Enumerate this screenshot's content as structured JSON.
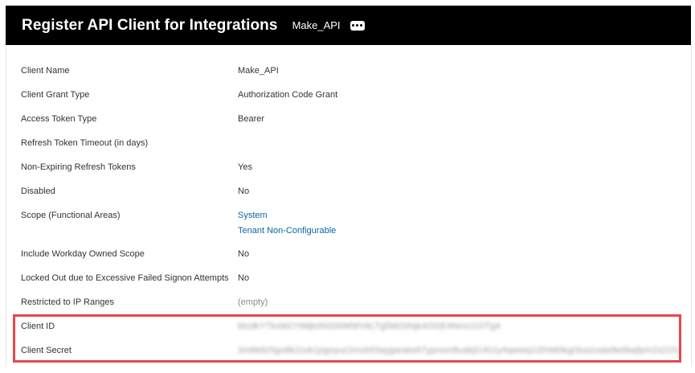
{
  "header": {
    "title": "Register API Client for Integrations",
    "subtitle": "Make_API",
    "related_actions_icon": "ellipsis-icon"
  },
  "fields": [
    {
      "label": "Client Name",
      "value": "Make_API"
    },
    {
      "label": "Client Grant Type",
      "value": "Authorization Code Grant"
    },
    {
      "label": "Access Token Type",
      "value": "Bearer"
    },
    {
      "label": "Refresh Token Timeout (in days)",
      "value": ""
    },
    {
      "label": "Non-Expiring Refresh Tokens",
      "value": "Yes"
    },
    {
      "label": "Disabled",
      "value": "No"
    },
    {
      "label": "Scope (Functional Areas)",
      "links": [
        "System",
        "Tenant Non-Configurable"
      ]
    },
    {
      "label": "Include Workday Owned Scope",
      "value": "No"
    },
    {
      "label": "Locked Out due to Excessive Failed Signon Attempts",
      "value": "No"
    },
    {
      "label": "Restricted to IP Ranges",
      "value": "(empty)"
    },
    {
      "label": "Client ID",
      "value": "MzdkYTkxM2YtMjk0NS00MWVkLTg5M2ItNjk4OGE4NmU1OTg4"
    },
    {
      "label": "Client Secret",
      "value": "3m6k8z5gn8k2zvk1pgoyuz2mzk93ayjpeatw67ypnsm8uakjl1401y4qwwq1i2h9d0kgi3sa1xaie8e6bqfpm2s2152"
    }
  ],
  "colors": {
    "header_bg": "#000000",
    "link": "#0b64a6",
    "highlight_border": "#e8474c"
  }
}
